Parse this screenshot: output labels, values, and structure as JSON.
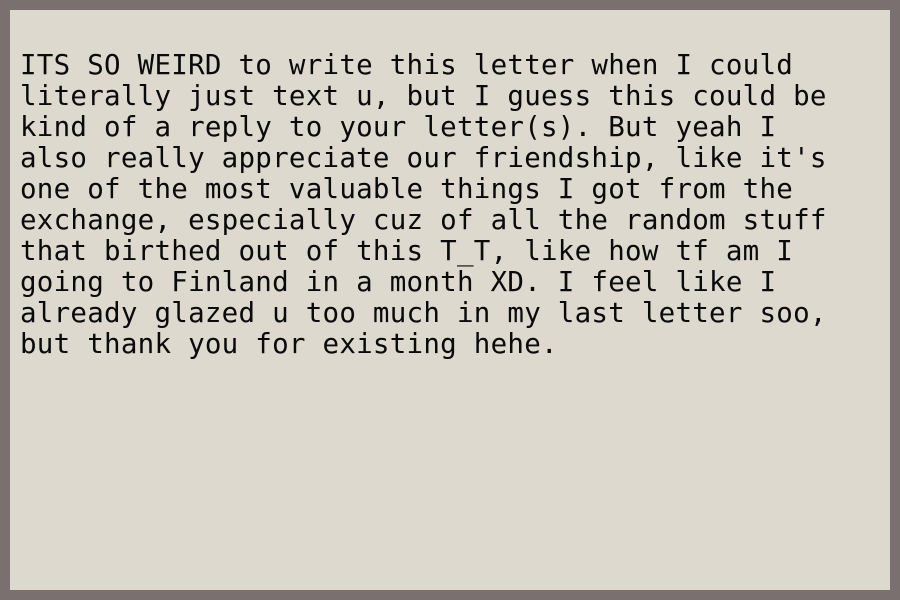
{
  "letter": {
    "lines": [
      "ITS SO WEIRD to write this letter when I could",
      "literally just text u, but I guess this could be",
      "kind of a reply to your letter(s). But yeah I",
      "also really appreciate our friendship, like it's",
      "one of the most valuable things I got from the",
      "exchange, especially cuz of all the random stuff",
      "that birthed out of this T_T, like how tf am I",
      "going to Finland in a month XD. I feel like I",
      "already glazed u too much in my last letter soo,",
      "but thank you for existing hehe."
    ]
  },
  "colors": {
    "frame_border": "#7b7070",
    "paper": "#ded9ce",
    "text": "#0a0a0a"
  }
}
